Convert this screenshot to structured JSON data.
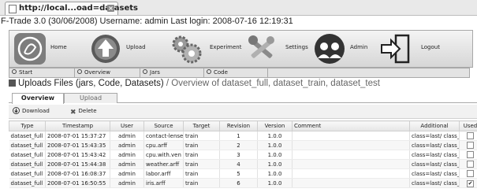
{
  "browser": {
    "tab_title": "http://local...oad=datasets"
  },
  "app": {
    "header_line": "F-Trade 3.0 (30/06/2008)  Username: admin Last login: 2008-07-16 12:19:31"
  },
  "menu": {
    "items": [
      {
        "label": "Home",
        "icon": "home-icon"
      },
      {
        "label": "Upload",
        "icon": "upload-icon"
      },
      {
        "label": "Experiment",
        "icon": "gears-icon"
      },
      {
        "label": "Settings",
        "icon": "tools-icon"
      },
      {
        "label": "Admin",
        "icon": "users-icon"
      },
      {
        "label": "Logout",
        "icon": "logout-icon"
      }
    ]
  },
  "subnav": {
    "items": [
      "Start",
      "Overview",
      "Jars",
      "Code"
    ]
  },
  "page": {
    "title": "Uploads Files (jars, Code, Datasets)",
    "subtitle": "/ Overview of dataset_full, dataset_train, dataset_test"
  },
  "tabs": [
    "Overview",
    "Upload"
  ],
  "toolbar": {
    "download": "Download",
    "delete": "Delete"
  },
  "grid": {
    "headers": [
      "Type",
      "Timestamp",
      "User",
      "Source",
      "Target",
      "Revision",
      "Version",
      "Comment",
      "Additional",
      "Used"
    ],
    "rows": [
      {
        "type": "dataset_full",
        "timestamp": "2008-07-01 15:37:27",
        "user": "admin",
        "source": "contact-lense",
        "target": "train",
        "revision": "1",
        "version": "1.0.0",
        "comment": "",
        "additional": "class=last/ class_ty",
        "used": false
      },
      {
        "type": "dataset_full",
        "timestamp": "2008-07-01 15:43:35",
        "user": "admin",
        "source": "cpu.arff",
        "target": "train",
        "revision": "2",
        "version": "1.0.0",
        "comment": "",
        "additional": "class=last/ class_ty",
        "used": false
      },
      {
        "type": "dataset_full",
        "timestamp": "2008-07-01 15:43:42",
        "user": "admin",
        "source": "cpu.with.ven",
        "target": "train",
        "revision": "3",
        "version": "1.0.0",
        "comment": "",
        "additional": "class=last/ class_ty",
        "used": false
      },
      {
        "type": "dataset_full",
        "timestamp": "2008-07-01 15:44:38",
        "user": "admin",
        "source": "weather.arff",
        "target": "train",
        "revision": "4",
        "version": "1.0.0",
        "comment": "",
        "additional": "class=last/ class_ty",
        "used": false
      },
      {
        "type": "dataset_full",
        "timestamp": "2008-07-01 16:08:37",
        "user": "admin",
        "source": "labor.arff",
        "target": "train",
        "revision": "5",
        "version": "1.0.0",
        "comment": "",
        "additional": "class=last/ class_ty",
        "used": false
      },
      {
        "type": "dataset_full",
        "timestamp": "2008-07-01 16:50:55",
        "user": "admin",
        "source": "iris.arff",
        "target": "train",
        "revision": "6",
        "version": "1.0.0",
        "comment": "",
        "additional": "class=last/ class_ty",
        "used": true
      }
    ]
  }
}
